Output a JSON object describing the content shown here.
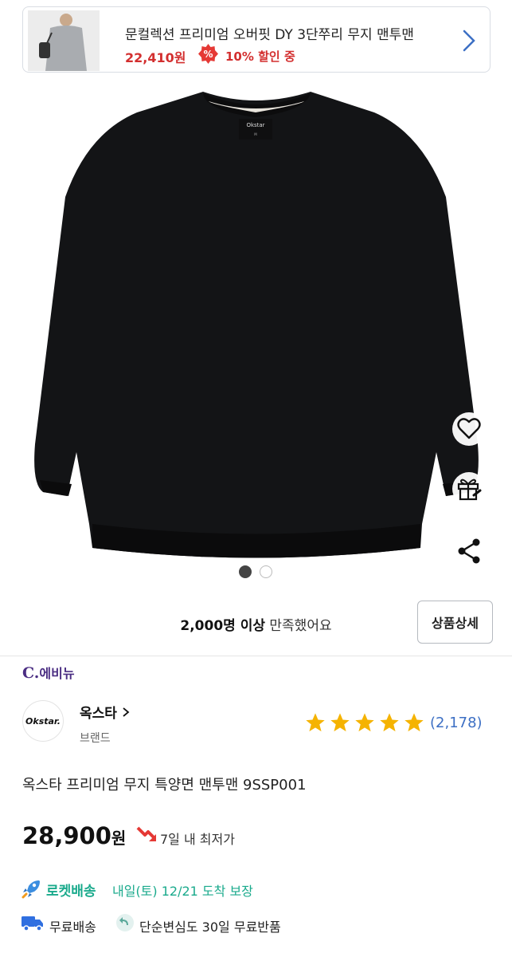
{
  "promo": {
    "title": "문컬렉션 프리미엄 오버핏 DY 3단쭈리 무지 맨투맨",
    "price": "22,410원",
    "badge_icon": "percent-badge-icon",
    "discount": "10% 할인 중",
    "chevron_icon": "chevron-right-icon"
  },
  "product": {
    "image_dots": 2,
    "active_dot": 0,
    "sweater_label": "Okstar"
  },
  "actions": {
    "like_icon": "heart-icon",
    "gift_icon": "gift-icon",
    "share_icon": "share-icon"
  },
  "satisfaction": {
    "count": "2,000명 이상",
    "text": " 만족했어요"
  },
  "detail_button": "상품상세",
  "seller": {
    "mark": "C.",
    "name": "에비뉴"
  },
  "brand": {
    "logo_text": "Okstar.",
    "name": "옥스타",
    "sub": "브랜드"
  },
  "rating": {
    "stars": 5,
    "review_count": "(2,178)"
  },
  "product_title": "옥스타 프리미엄 무지 특양면 맨투맨 9SSP001",
  "price": {
    "amount": "28,900",
    "unit": "원",
    "lowest_label": "7일 내 최저가"
  },
  "delivery": {
    "rocket_label": "로켓배송",
    "arrival": "내일(토) 12/21 도착 보장",
    "free_shipping": "무료배송",
    "free_return": "단순변심도 30일 무료반품"
  },
  "colors": {
    "price_red": "#d32f2f",
    "rocket_teal": "#1aaa8c",
    "star_gold": "#f5b301",
    "review_blue": "#3c6fc4",
    "seller_purple": "#4b2e83"
  }
}
